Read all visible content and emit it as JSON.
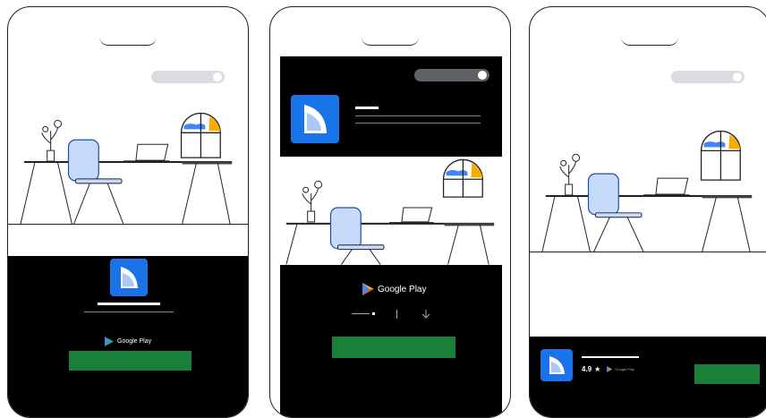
{
  "store": {
    "name": "Google Play",
    "rating": "4.9",
    "star": "★"
  },
  "colors": {
    "accent_blue": "#1a73e8",
    "install_green": "#188038",
    "sun_yellow": "#f9ab00",
    "sky_blue": "#4285f4",
    "chair_blue": "#c6dafc",
    "toggle_gray": "#dadce0",
    "toggle_dark": "#5f6368",
    "banner_black": "#000000"
  },
  "icons": [
    "app-logo-icon",
    "google-play-icon",
    "star-icon",
    "download-arrow-icon"
  ]
}
